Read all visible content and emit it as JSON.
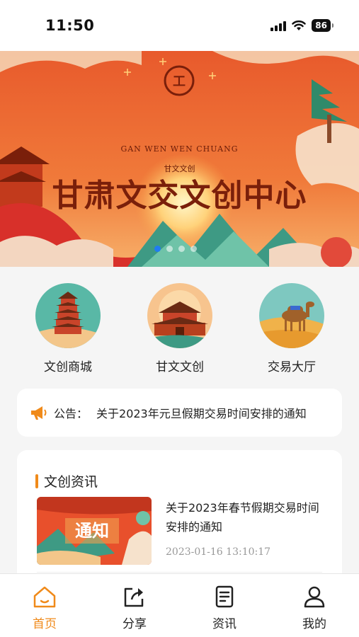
{
  "status_bar": {
    "time": "11:50",
    "battery": "86"
  },
  "banner": {
    "logo_text": "GAN WEN WEN CHUANG",
    "logo_sub": "甘文文创",
    "title": "甘肃文交文创中心",
    "dots": 4,
    "active_dot": 0
  },
  "categories": [
    {
      "label": "文创商城",
      "icon": "pagoda-tower-icon"
    },
    {
      "label": "甘文文创",
      "icon": "city-gate-icon"
    },
    {
      "label": "交易大厅",
      "icon": "camel-desert-icon"
    }
  ],
  "notice": {
    "icon": "megaphone-icon",
    "prefix": "公告：",
    "text": "关于2023年元旦假期交易时间安排的通知"
  },
  "news": {
    "section_title": "文创资讯",
    "items": [
      {
        "thumb_text": "通知",
        "title": "关于2023年春节假期交易时间安排的通知",
        "date": "2023-01-16 13:10:17"
      }
    ]
  },
  "tabbar": [
    {
      "label": "首页",
      "icon": "home-icon",
      "active": true
    },
    {
      "label": "分享",
      "icon": "share-icon",
      "active": false
    },
    {
      "label": "资讯",
      "icon": "news-icon",
      "active": false
    },
    {
      "label": "我的",
      "icon": "user-icon",
      "active": false
    }
  ],
  "colors": {
    "accent": "#f08a1a",
    "banner_red": "#e8502c",
    "active_dot": "#1f7cf2"
  }
}
